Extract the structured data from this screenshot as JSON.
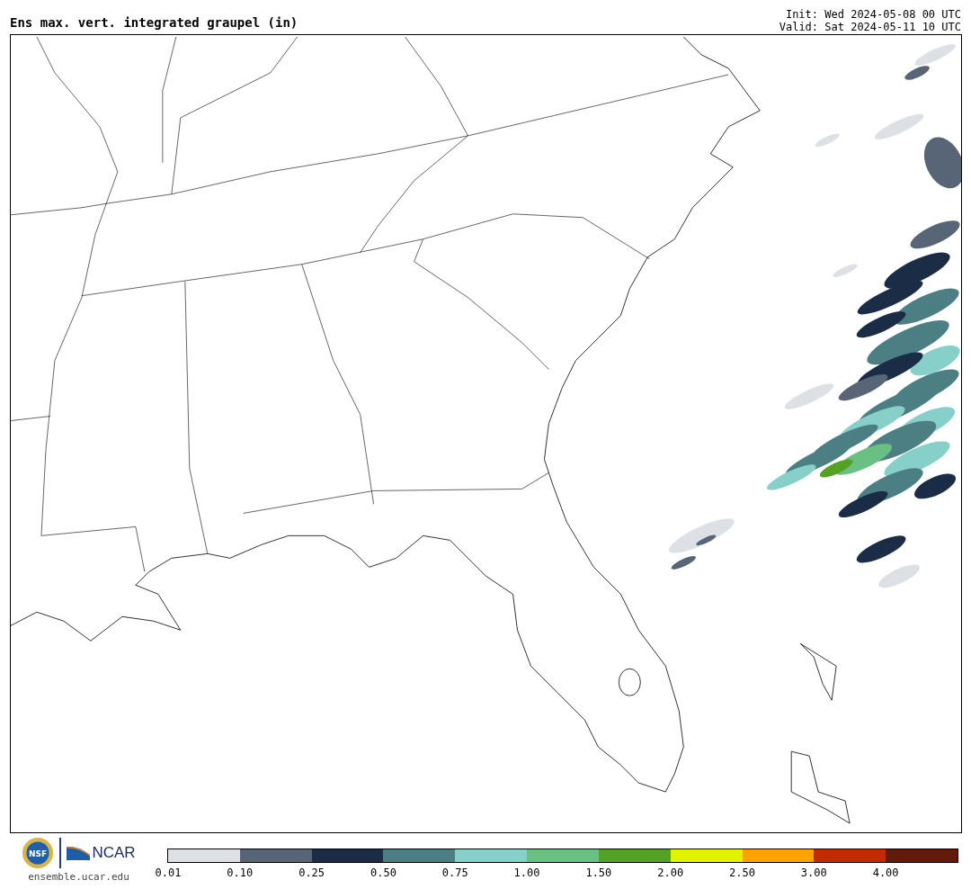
{
  "title": "Ens max. vert. integrated graupel (in)",
  "init": "Init: Wed 2024-05-08 00 UTC",
  "valid": "Valid: Sat 2024-05-11 10 UTC",
  "logos": {
    "seal_text": "NSF",
    "org_text": "NCAR",
    "site": "ensemble.ucar.edu"
  },
  "colorbar": [
    {
      "label": "0.01",
      "color": "#dde1e5"
    },
    {
      "label": "0.10",
      "color": "#586577"
    },
    {
      "label": "0.25",
      "color": "#1b2d46"
    },
    {
      "label": "0.50",
      "color": "#4b7f84"
    },
    {
      "label": "0.75",
      "color": "#86d0c9"
    },
    {
      "label": "1.00",
      "color": "#6abf82"
    },
    {
      "label": "1.50",
      "color": "#54a123"
    },
    {
      "label": "2.00",
      "color": "#e2f200"
    },
    {
      "label": "2.50",
      "color": "#ffa200"
    },
    {
      "label": "3.00",
      "color": "#c22a00"
    },
    {
      "label": "4.00",
      "color": "#621a0b"
    }
  ]
}
